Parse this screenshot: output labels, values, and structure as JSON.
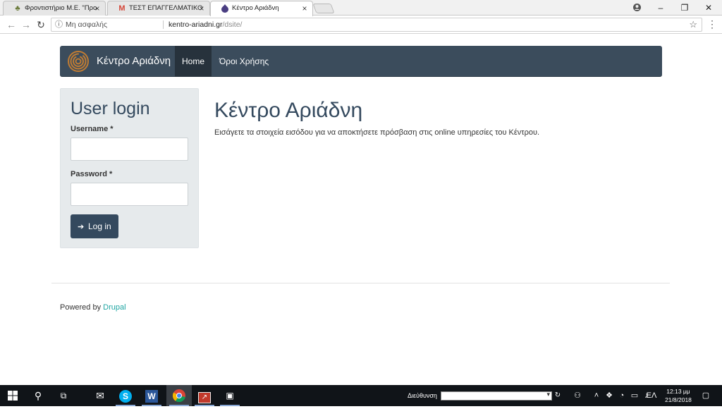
{
  "browser": {
    "tabs": [
      {
        "title": "Φροντιστήριο Μ.Ε. \"Προ",
        "icon": "tree-favicon-icon"
      },
      {
        "title": "ΤΕΣΤ ΕΠΑΓΓΕΛΜΑΤΙΚΟΥ Π",
        "icon": "gmail-icon"
      },
      {
        "title": "Κέντρο Αριάδνη",
        "icon": "drupal-icon"
      }
    ],
    "address": {
      "security": "Μη ασφαλής",
      "host": "kentro-ariadni.gr",
      "path": "/dsite/"
    }
  },
  "site": {
    "name": "Κέντρο Αριάδνη",
    "nav": {
      "home": "Home",
      "terms": "Όροι Χρήσης"
    },
    "colors": {
      "nav_bg": "#3b4c5c",
      "accent": "#34495e",
      "link": "#1ea5a2"
    }
  },
  "login": {
    "title": "User login",
    "username_label": "Username",
    "password_label": "Password",
    "required_mark": "*",
    "username_value": "",
    "password_value": "",
    "button_label": "Log in"
  },
  "main": {
    "title": "Κέντρο Αριάδνη",
    "text": "Εισάγετε τα στοιχεία εισόδου για να αποκτήσετε πρόσβαση στις online υπηρεσίες του Κέντρου."
  },
  "footer": {
    "prefix": "Powered by",
    "link": "Drupal"
  },
  "taskbar": {
    "address_label": "Διεύθυνση",
    "address_value": "",
    "language": "ΕΛ",
    "time": "12:13 μμ",
    "date": "21/8/2018"
  }
}
